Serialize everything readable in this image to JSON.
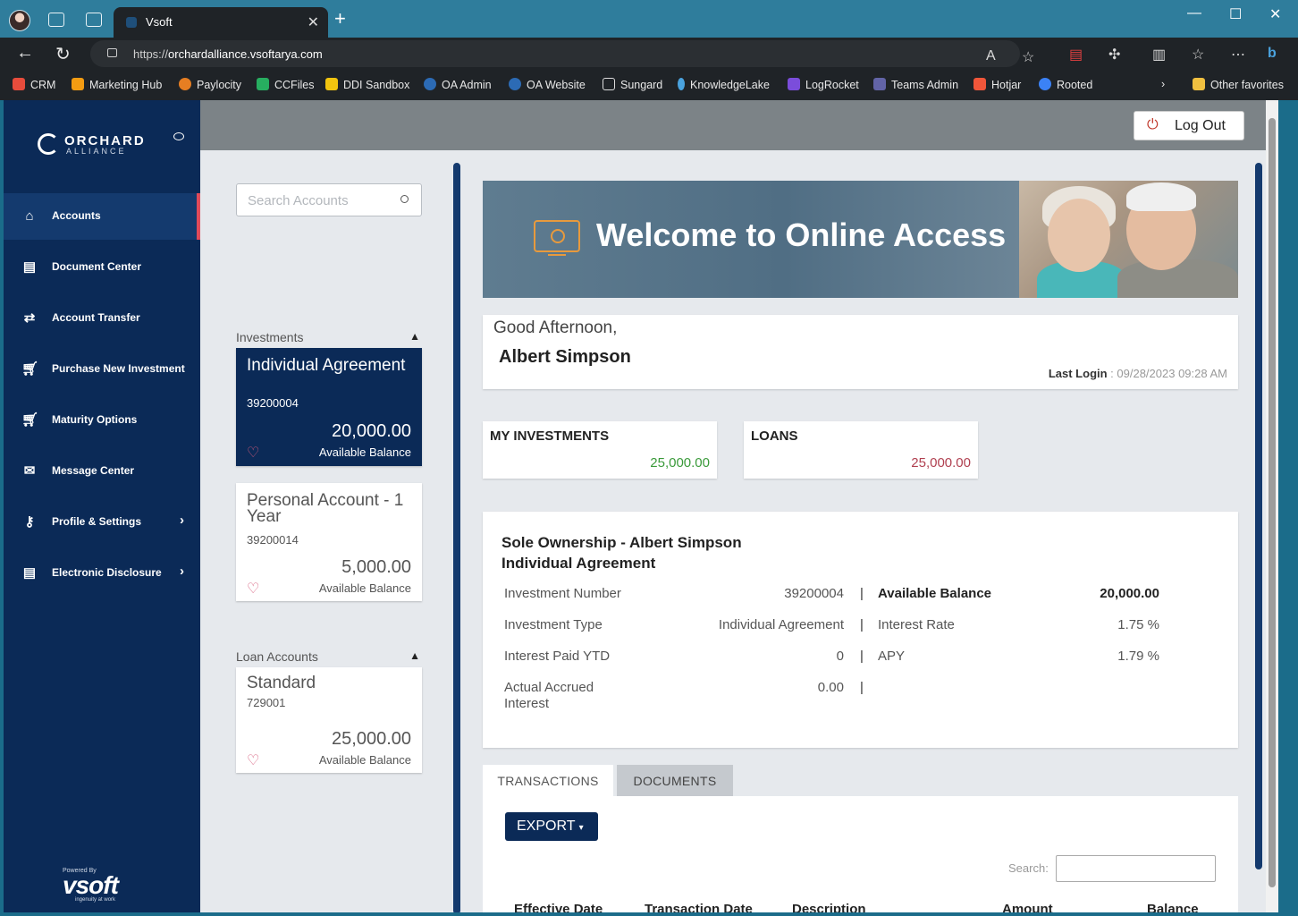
{
  "browser": {
    "tab_title": "Vsoft",
    "url_prefix": "https://",
    "url_domain": "orchardalliance.vsoftarya.com",
    "bookmarks": [
      {
        "label": "CRM",
        "color": "#e74c3c"
      },
      {
        "label": "Marketing Hub",
        "color": "#f39c12"
      },
      {
        "label": "Paylocity",
        "color": "#e67e22"
      },
      {
        "label": "CCFiles",
        "color": "#27ae60"
      },
      {
        "label": "DDI Sandbox",
        "color": "#f1c40f"
      },
      {
        "label": "OA Admin",
        "color": "#2c6bb5"
      },
      {
        "label": "OA Website",
        "color": "#2c6bb5"
      },
      {
        "label": "Sungard",
        "color": "#ffffff"
      },
      {
        "label": "KnowledgeLake",
        "color": "#4aa3df"
      },
      {
        "label": "LogRocket",
        "color": "#7b4ddb"
      },
      {
        "label": "Teams Admin",
        "color": "#6264a7"
      },
      {
        "label": "Hotjar",
        "color": "#f0563a"
      },
      {
        "label": "Rooted",
        "color": "#3b82f6"
      }
    ],
    "other_favorites": "Other favorites"
  },
  "brand": {
    "name": "ORCHARD",
    "sub": "ALLIANCE",
    "powered_by": "Powered By",
    "vendor": "vsoft",
    "tagline": "ingenuity at work"
  },
  "sidebar": {
    "items": [
      {
        "label": "Accounts",
        "icon": "home-icon",
        "active": true
      },
      {
        "label": "Document Center",
        "icon": "document-icon"
      },
      {
        "label": "Account Transfer",
        "icon": "transfer-icon"
      },
      {
        "label": "Purchase New Investment",
        "icon": "cart-icon"
      },
      {
        "label": "Maturity Options",
        "icon": "cart-icon"
      },
      {
        "label": "Message Center",
        "icon": "envelope-icon"
      },
      {
        "label": "Profile & Settings",
        "icon": "key-icon",
        "has_submenu": true
      },
      {
        "label": "Electronic Disclosure",
        "icon": "document-icon",
        "has_submenu": true
      }
    ]
  },
  "header": {
    "logout_label": "Log Out"
  },
  "accounts_panel": {
    "search_placeholder": "Search Accounts",
    "investments_heading": "Investments",
    "loans_heading": "Loan Accounts",
    "investments": [
      {
        "name": "Individual Agreement",
        "number": "39200004",
        "balance": "20,000.00",
        "balance_label": "Available Balance",
        "selected": true
      },
      {
        "name": "Personal Account - 1 Year",
        "number": "39200014",
        "balance": "5,000.00",
        "balance_label": "Available Balance"
      }
    ],
    "loans": [
      {
        "name": "Standard",
        "number": "729001",
        "balance": "25,000.00",
        "balance_label": "Available Balance"
      }
    ]
  },
  "main": {
    "banner_title": "Welcome to Online Access",
    "greeting": "Good Afternoon,",
    "user_name": "Albert Simpson",
    "last_login_label": "Last Login",
    "last_login_value": " : 09/28/2023 09:28 AM",
    "totals": [
      {
        "label": "MY INVESTMENTS",
        "value": "25,000.00",
        "color": "#3a9a3a"
      },
      {
        "label": "LOANS",
        "value": "25,000.00",
        "color": "#b04050"
      }
    ],
    "detail": {
      "title_line1": "Sole Ownership - Albert Simpson",
      "title_line2": "Individual Agreement",
      "rows": [
        {
          "k": "Investment Number",
          "v": "39200004",
          "k2": "Available Balance",
          "v2": "20,000.00",
          "bold2": true
        },
        {
          "k": "Investment Type",
          "v": "Individual Agreement",
          "k2": "Interest Rate",
          "v2": "1.75 %"
        },
        {
          "k": "Interest Paid YTD",
          "v": "0",
          "k2": "APY",
          "v2": "1.79 %"
        },
        {
          "k": "Actual Accrued Interest",
          "v": "0.00",
          "k2": "",
          "v2": ""
        }
      ]
    },
    "tabs": [
      "TRANSACTIONS",
      "DOCUMENTS"
    ],
    "export_label": "EXPORT",
    "search_label": "Search:",
    "columns": [
      "Effective Date",
      "Transaction Date",
      "Description",
      "Amount",
      "Balance"
    ]
  }
}
